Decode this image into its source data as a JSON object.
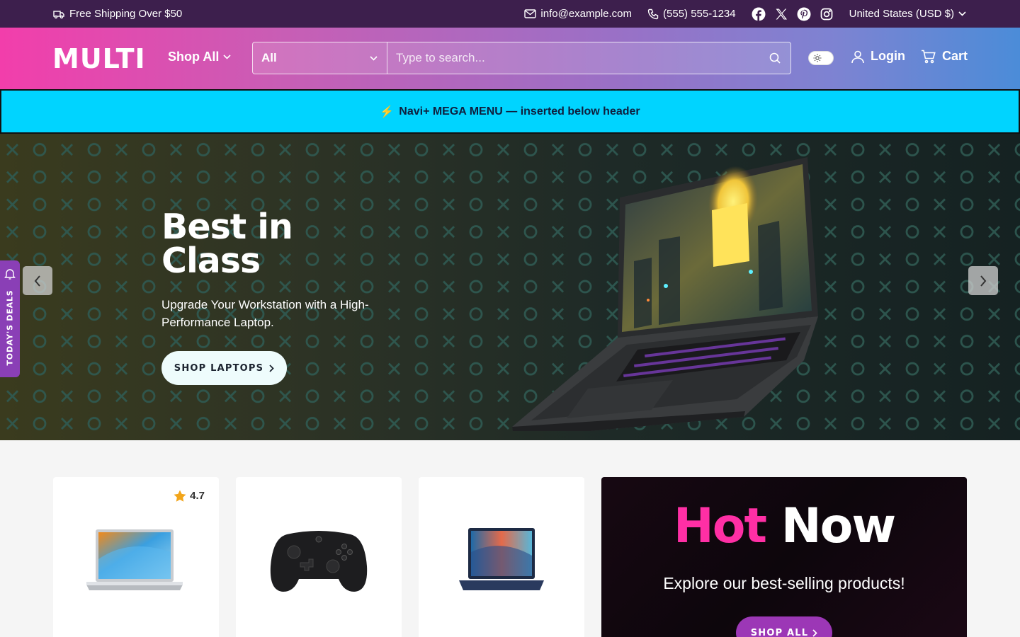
{
  "topbar": {
    "shipping": "Free Shipping Over $50",
    "email": "info@example.com",
    "phone": "(555) 555-1234",
    "social_icons": [
      "facebook-icon",
      "x-icon",
      "pinterest-icon",
      "instagram-icon"
    ],
    "currency": "United States (USD $)"
  },
  "header": {
    "logo": "MULTI",
    "shop_all": "Shop All",
    "search_category": "All",
    "search_placeholder": "Type to search...",
    "login": "Login",
    "cart": "Cart"
  },
  "mega_menu": {
    "icon": "⚡",
    "text": "Navi+ MEGA MENU — inserted below header"
  },
  "hero": {
    "title": "Best in Class",
    "subtitle": "Upgrade Your Workstation with a High-Performance Laptop.",
    "button": "SHOP LAPTOPS"
  },
  "deals_tab": {
    "label": "TODAY'S DEALS"
  },
  "products": [
    {
      "rating": "4.7",
      "image": "laptop-silver"
    },
    {
      "rating": "",
      "image": "game-controller"
    },
    {
      "rating": "",
      "image": "laptop-navy"
    }
  ],
  "promo": {
    "title_part1": "Hot",
    "title_part2": "Now",
    "subtitle": "Explore our best-selling products!",
    "button": "SHOP ALL"
  },
  "colors": {
    "topbar": "#3d1f4d",
    "header_gradient_start": "#f23eab",
    "header_gradient_end": "#4b8cd8",
    "mega_bg": "#00d4ff",
    "accent_pink": "#ff2fa5",
    "deals_purple": "#8a3fb6"
  }
}
